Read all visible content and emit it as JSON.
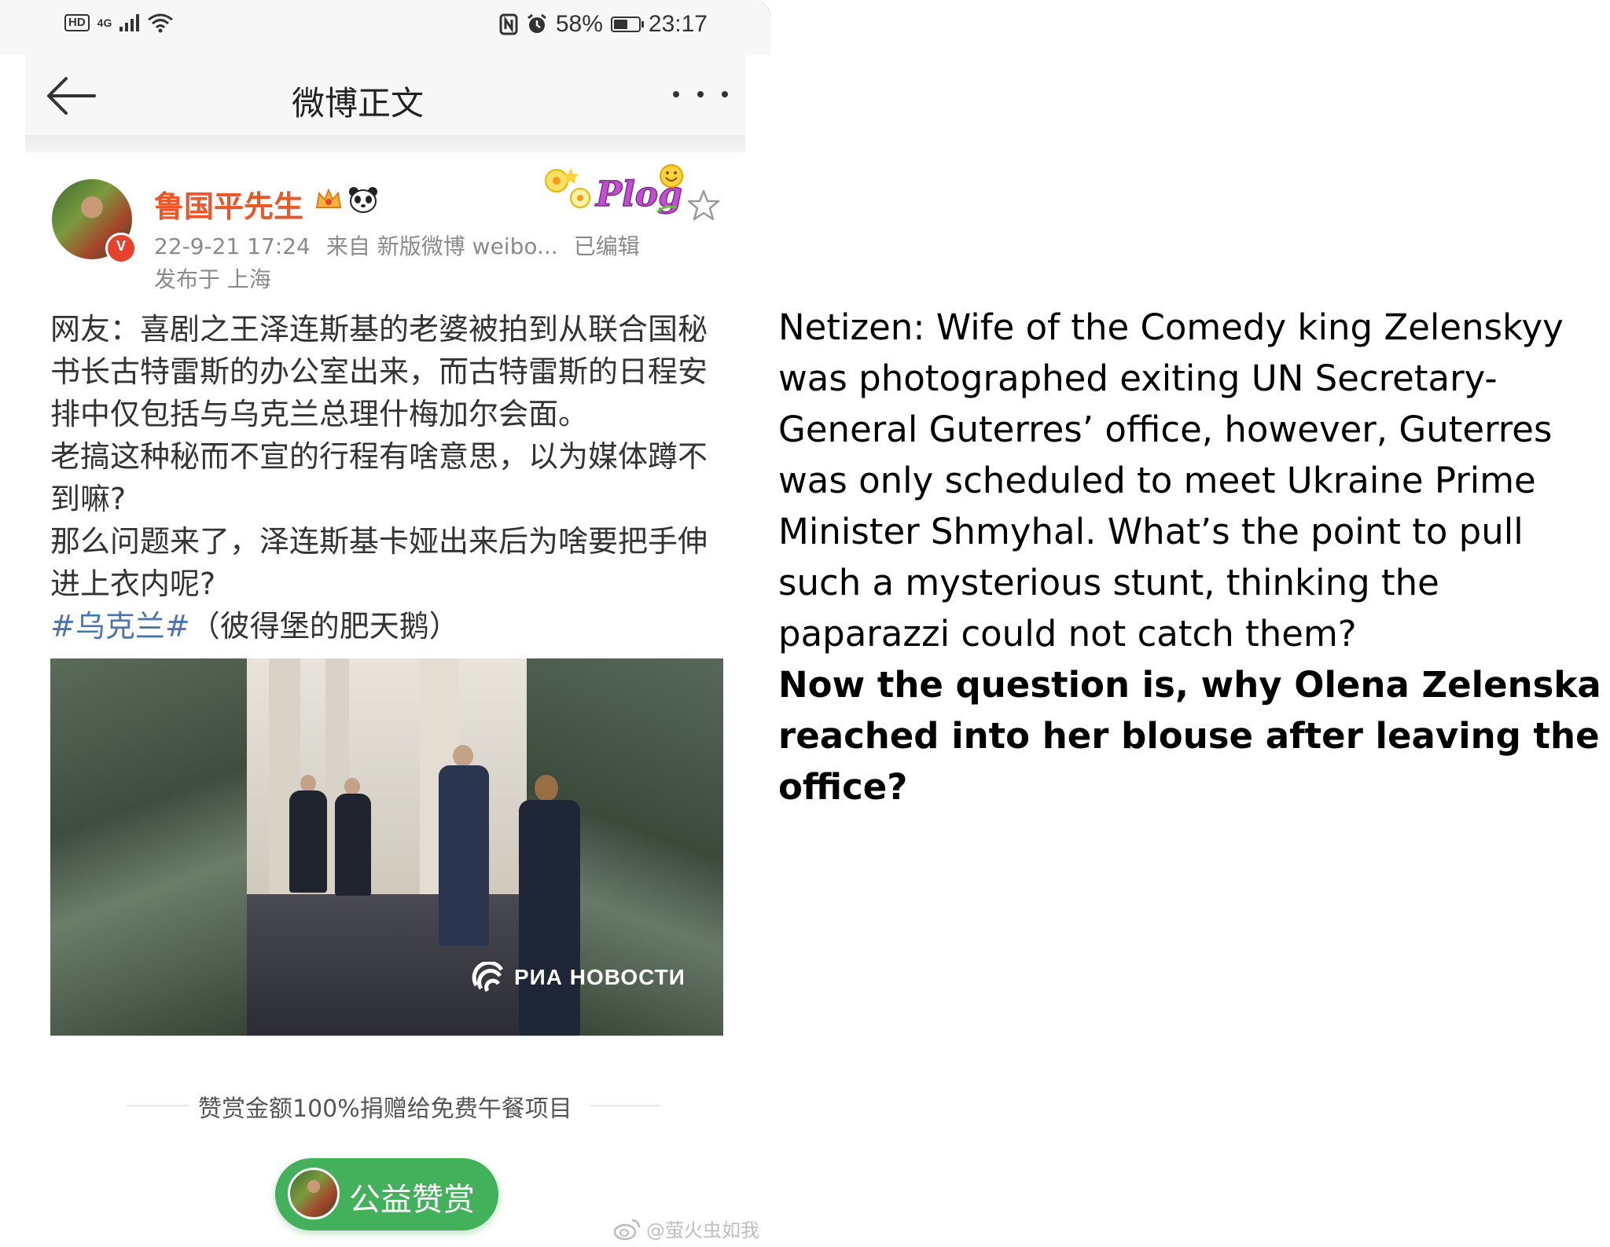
{
  "status_bar": {
    "hd": "HD",
    "network": "4G",
    "battery_text": "58%",
    "battery_level": 0.58,
    "time": "23:17"
  },
  "nav": {
    "title": "微博正文"
  },
  "post": {
    "author": "鲁国平先生",
    "verified_mark": "V",
    "sticker_text": "Plog",
    "meta": {
      "date": "22-9-21 17:24",
      "source": "来自 新版微博 weibo...",
      "edited": "已编辑"
    },
    "location": "发布于 上海",
    "body": [
      "网友：喜剧之王泽连斯基的老婆被拍到从联合国秘书长古特雷斯的办公室出来，而古特雷斯的日程安排中仅包括与乌克兰总理什梅加尔会面。",
      "老搞这种秘而不宣的行程有啥意思，以为媒体蹲不到嘛?",
      "那么问题来了，泽连斯基卡娅出来后为啥要把手伸进上衣内呢?"
    ],
    "hashtag": "#乌克兰#",
    "hashtag_note": "（彼得堡的肥天鹅）",
    "image_watermark": "РИА НОВОСТИ"
  },
  "reward": {
    "note": "赞赏金额100%捐赠给免费午餐项目",
    "button_label": "公益赞赏"
  },
  "watermark": "@萤火虫如我",
  "annotation": {
    "paragraph": "Netizen: Wife of the Comedy king Zelenskyy was photographed exiting UN Secretary-General Guterres’ office, however, Guterres was only scheduled to meet Ukraine Prime Minister Shmyhal. What’s the point to pull such a mysterious stunt, thinking the paparazzi could not catch them?",
    "bold_paragraph": "Now the question is, why Olena Zelenska reached into her blouse after leaving the office?"
  }
}
